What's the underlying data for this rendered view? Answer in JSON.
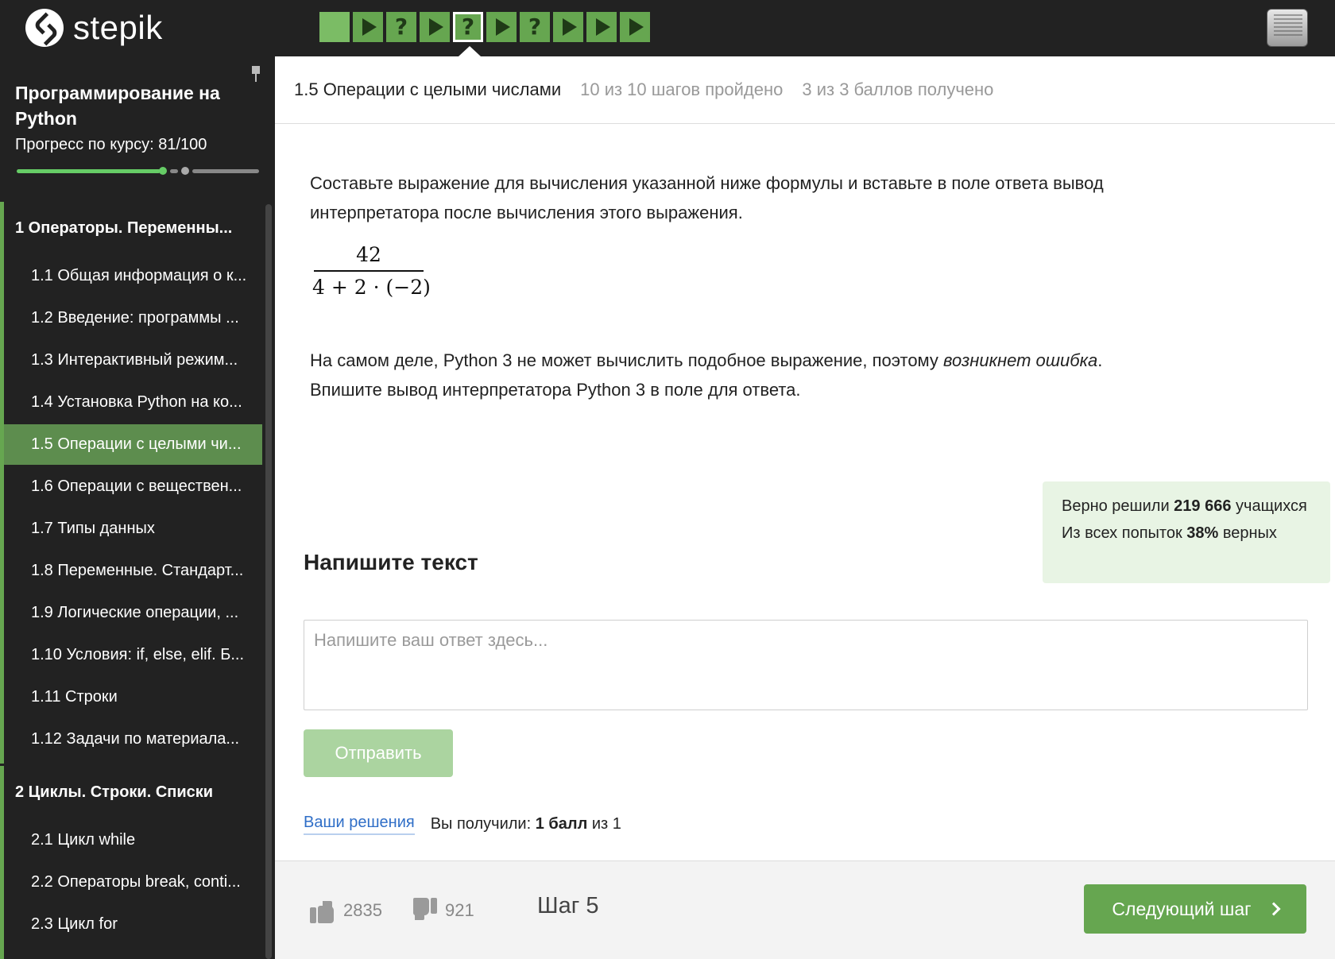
{
  "app": {
    "logo_text": "stepik"
  },
  "step_nav": [
    {
      "kind": "text"
    },
    {
      "kind": "video"
    },
    {
      "kind": "quiz"
    },
    {
      "kind": "video"
    },
    {
      "kind": "quiz",
      "current": true
    },
    {
      "kind": "video"
    },
    {
      "kind": "quiz"
    },
    {
      "kind": "video"
    },
    {
      "kind": "video"
    },
    {
      "kind": "video"
    }
  ],
  "sidebar": {
    "course_title": "Программирование на Python",
    "progress_label": "Прогресс по курсу:  81/100",
    "progress": {
      "earned": 81,
      "total": 100
    },
    "modules": [
      {
        "label": "1  Операторы. Переменны...",
        "lessons": [
          {
            "label": "1.1  Общая информация о к..."
          },
          {
            "label": "1.2  Введение: программы ..."
          },
          {
            "label": "1.3  Интерактивный режим..."
          },
          {
            "label": "1.4  Установка Python на ко..."
          },
          {
            "label": "1.5  Операции с целыми чи...",
            "active": true
          },
          {
            "label": "1.6  Операции с веществен..."
          },
          {
            "label": "1.7  Типы данных"
          },
          {
            "label": "1.8  Переменные. Стандарт..."
          },
          {
            "label": "1.9  Логические операции, ..."
          },
          {
            "label": "1.10  Условия: if, else, elif. Б..."
          },
          {
            "label": "1.11  Строки"
          },
          {
            "label": "1.12  Задачи по материала..."
          }
        ]
      },
      {
        "label": "2  Циклы. Строки. Списки",
        "lessons": [
          {
            "label": "2.1  Цикл while"
          },
          {
            "label": "2.2  Операторы break, conti..."
          },
          {
            "label": "2.3  Цикл for"
          }
        ]
      }
    ]
  },
  "header": {
    "lesson_name": "1.5 Операции с целыми числами",
    "steps_passed": "10 из 10 шагов пройдено",
    "points": "3 из 3 баллов  получено"
  },
  "task": {
    "paragraph1": "Составьте выражение для вычисления указанной ниже формулы и вставьте в поле ответа вывод интерпретатора после вычисления этого выражения.",
    "formula_numerator": "42",
    "formula_denominator": "4 + 2 · (−2)",
    "paragraph2_before": "На самом деле, Python 3 не может вычислить подобное выражение, поэтому ",
    "paragraph2_em": "возникнет ошибка",
    "paragraph2_after": ".",
    "paragraph3": "Впишите вывод интерпретатора Python 3 в поле для ответа."
  },
  "stats": {
    "solved_prefix": "Верно решили ",
    "solved_count": "219 666",
    "solved_suffix": " учащихся",
    "attempts_prefix": "Из всех попыток ",
    "attempts_percent": "38%",
    "attempts_suffix": " верных"
  },
  "answer": {
    "title": "Напишите текст",
    "placeholder": "Напишите ваш ответ здесь...",
    "value": "",
    "submit_label": "Отправить"
  },
  "result": {
    "solutions_link": "Ваши решения",
    "score_prefix": "Вы получили: ",
    "score_bold": "1 балл",
    "score_suffix": " из 1"
  },
  "footer": {
    "likes": "2835",
    "dislikes": "921",
    "step_label": "Шаг 5",
    "next_label": "Следующий шаг"
  },
  "colors": {
    "accent": "#66a650",
    "topbar": "#222222",
    "sidebar": "#222222",
    "active_lesson": "#5d8d4e",
    "stats_bg": "#e8f4e4",
    "link": "#2f6ec7"
  }
}
